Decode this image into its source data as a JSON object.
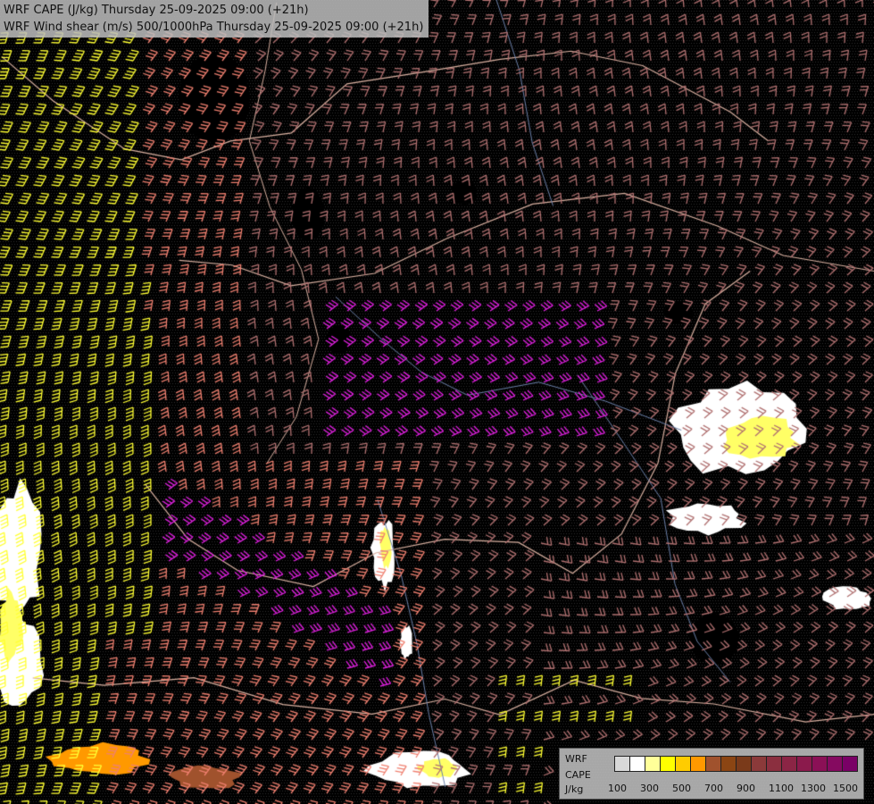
{
  "title": {
    "line1": "WRF CAPE (J/kg) Thursday 25-09-2025 09:00 (+21h)",
    "line2": "WRF Wind shear (m/s) 500/1000hPa Thursday 25-09-2025 09:00 (+21h)"
  },
  "legend": {
    "label_line1": "WRF",
    "label_line2": "CAPE",
    "label_line3": "J/kg",
    "colors": [
      "#d9d9d9",
      "#ffffff",
      "#ffff99",
      "#ffff00",
      "#ffcc00",
      "#ff9900",
      "#a0522d",
      "#8b4513",
      "#7a3a1a",
      "#8b3a3a",
      "#8b2f3f",
      "#8b2545",
      "#8b1a4c",
      "#8b1056",
      "#850a60",
      "#7a0066"
    ],
    "ticks": [
      "100",
      "300",
      "500",
      "700",
      "900",
      "1100",
      "1300",
      "1500"
    ]
  },
  "map_colors": {
    "background": "#000000",
    "shear_low": "#ffff33",
    "shear_mid": "#f08070",
    "shear_dim": "#b07070",
    "shear_high": "#e020e0",
    "border": "#d9b0a0",
    "river": "#6a7fa8",
    "cape_white": "#ffffff",
    "cape_yellow": "#ffff66"
  }
}
